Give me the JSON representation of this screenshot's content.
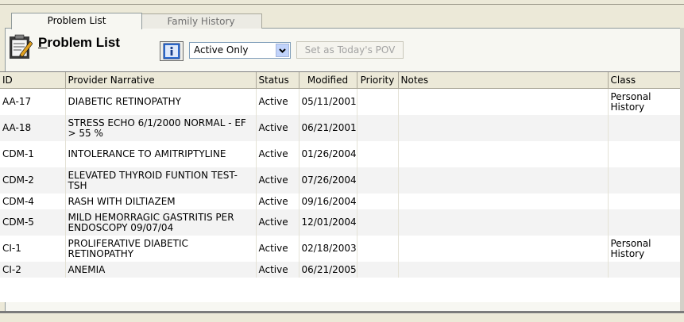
{
  "tabs": [
    {
      "label": "Problem List",
      "active": true
    },
    {
      "label": "Family History",
      "active": false
    }
  ],
  "toolbar": {
    "title_underlined": "P",
    "title_rest": "roblem List",
    "filter_value": "Active Only",
    "pov_button": "Set as Today's POV"
  },
  "icons": {
    "problem_list": "clipboard-edit-icon",
    "info": "info-icon",
    "dropdown": "chevron-down-icon"
  },
  "table": {
    "columns": [
      "ID",
      "Provider Narrative",
      "Status",
      "Modified",
      "Priority",
      "Notes",
      "Class"
    ],
    "rows": [
      {
        "id": "AA-17",
        "narrative": "DIABETIC RETINOPATHY",
        "status": "Active",
        "modified": "05/11/2001",
        "priority": "",
        "notes": "",
        "class": "Personal History"
      },
      {
        "id": "AA-18",
        "narrative": "STRESS ECHO 6/1/2000 NORMAL - EF > 55 %",
        "status": "Active",
        "modified": "06/21/2001",
        "priority": "",
        "notes": "",
        "class": ""
      },
      {
        "id": "CDM-1",
        "narrative": "INTOLERANCE TO AMITRIPTYLINE",
        "status": "Active",
        "modified": "01/26/2004",
        "priority": "",
        "notes": "",
        "class": ""
      },
      {
        "id": "CDM-2",
        "narrative": "ELEVATED THYROID FUNTION TEST-TSH",
        "status": "Active",
        "modified": "07/26/2004",
        "priority": "",
        "notes": "",
        "class": ""
      },
      {
        "id": "CDM-4",
        "narrative": "RASH WITH DILTIAZEM",
        "status": "Active",
        "modified": "09/16/2004",
        "priority": "",
        "notes": "",
        "class": ""
      },
      {
        "id": "CDM-5",
        "narrative": "MILD HEMORRAGIC GASTRITIS PER ENDOSCOPY 09/07/04",
        "status": "Active",
        "modified": "12/01/2004",
        "priority": "",
        "notes": "",
        "class": ""
      },
      {
        "id": "CI-1",
        "narrative": "PROLIFERATIVE DIABETIC RETINOPATHY",
        "status": "Active",
        "modified": "02/18/2003",
        "priority": "",
        "notes": "",
        "class": "Personal History"
      },
      {
        "id": "CI-2",
        "narrative": "ANEMIA",
        "status": "Active",
        "modified": "06/21/2005",
        "priority": "",
        "notes": "",
        "class": ""
      }
    ]
  }
}
